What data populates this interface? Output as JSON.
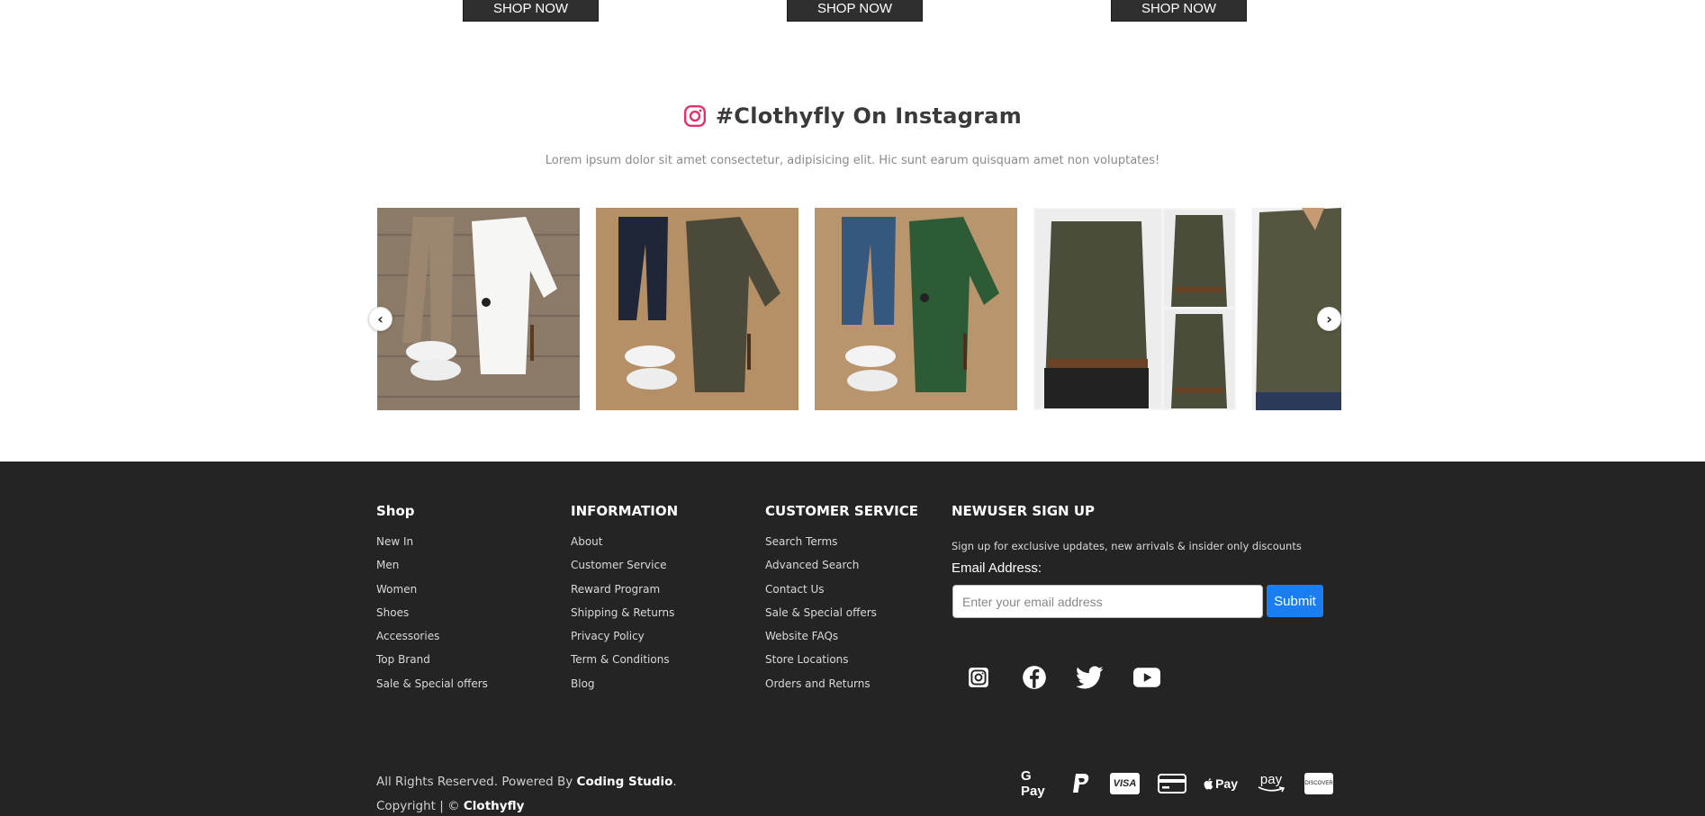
{
  "top_buttons": [
    "SHOP NOW",
    "SHOP NOW",
    "SHOP NOW"
  ],
  "instagram": {
    "title": "#Clothyfly On Instagram",
    "subtitle": "Lorem ipsum dolor sit amet consectetur, adipisicing elit. Hic sunt earum quisquam amet non voluptates!",
    "icon": "instagram-icon",
    "prev_icon": "chevron-left-icon",
    "next_icon": "chevron-right-icon",
    "prev": "‹",
    "next": "›"
  },
  "footer": {
    "shop": {
      "heading": "Shop",
      "items": [
        "New In",
        "Men",
        "Women",
        "Shoes",
        "Accessories",
        "Top Brand",
        "Sale & Special offers"
      ]
    },
    "information": {
      "heading": "INFORMATION",
      "items": [
        "About",
        "Customer Service",
        "Reward Program",
        "Shipping & Returns",
        "Privacy Policy",
        "Term & Conditions",
        "Blog"
      ]
    },
    "customer_service": {
      "heading": "CUSTOMER SERVICE",
      "items": [
        "Search Terms",
        "Advanced Search",
        "Contact Us",
        "Sale & Special offers",
        "Website FAQs",
        "Store Locations",
        "Orders and Returns"
      ]
    },
    "signup": {
      "heading": "NEWUSER SIGN UP",
      "description": "Sign up for exclusive updates, new arrivals & insider only discounts",
      "email_label": "Email Address:",
      "email_value": "",
      "email_placeholder": "Enter your email address",
      "submit_label": "Submit"
    },
    "social_icons": [
      "instagram-icon",
      "facebook-icon",
      "twitter-icon",
      "youtube-icon"
    ],
    "copyright": {
      "line1_prefix": "All Rights Reserved. Powered By ",
      "line1_brand": "Coding Studio",
      "line1_suffix": ".",
      "line2_prefix": "Copyright | © ",
      "line2_brand": "Clothyfly"
    },
    "payment_methods": [
      "google-pay-icon",
      "paypal-icon",
      "visa-icon",
      "credit-card-icon",
      "apple-pay-icon",
      "amazon-pay-icon",
      "discover-icon"
    ],
    "payment_labels": {
      "gpay": "G Pay",
      "visa": "VISA",
      "applepay": "Pay",
      "amazonpay": "pay",
      "discover": "DISCOVER"
    }
  },
  "colors": {
    "footer_bg": "#242424",
    "button_dark": "#2f2f2f",
    "submit_blue": "#1a7df0",
    "instagram_red": "#e1306c"
  }
}
